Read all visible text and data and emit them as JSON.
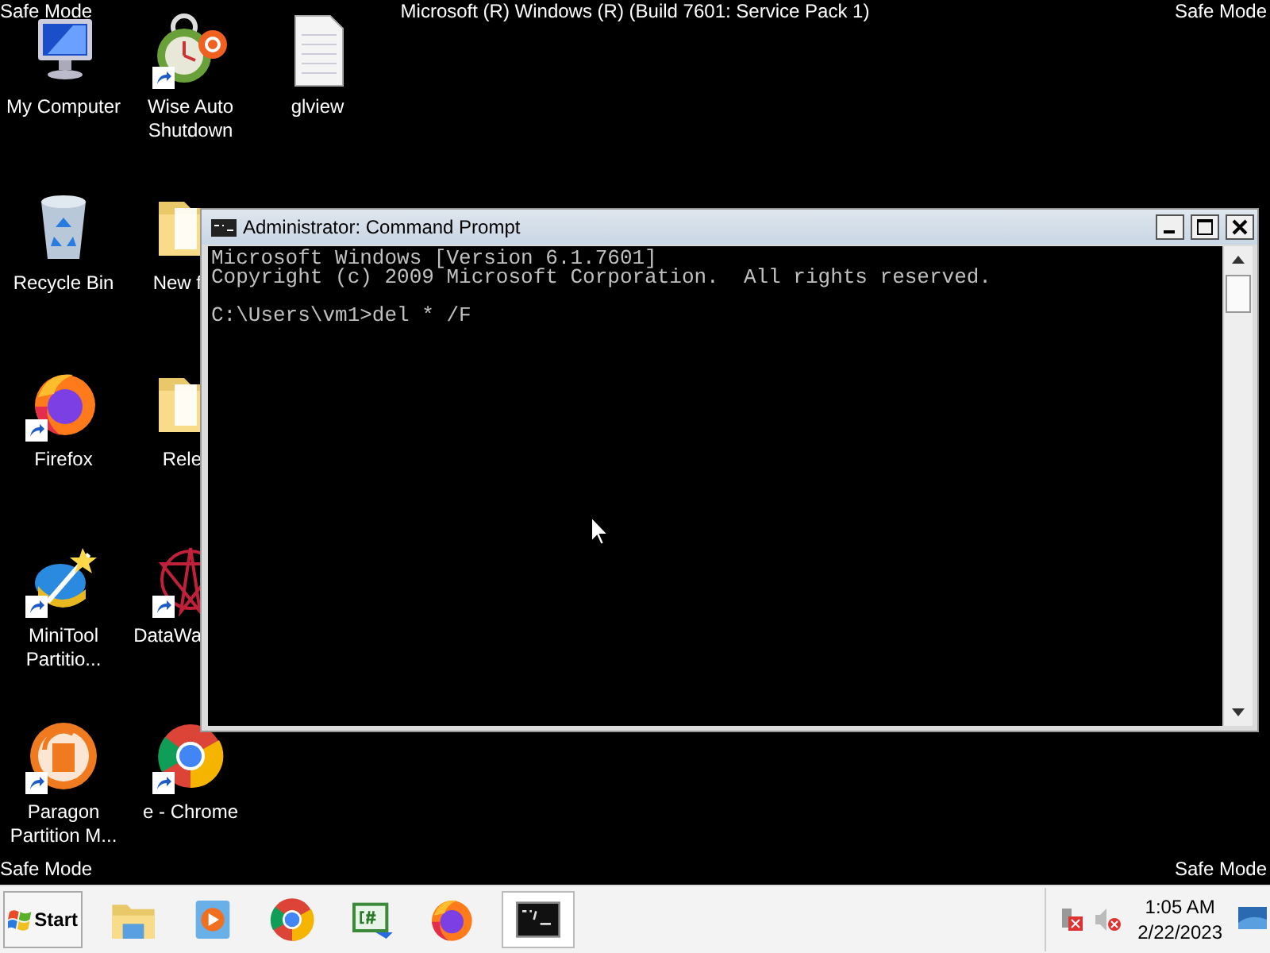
{
  "overlay_labels": {
    "top_left": "Safe Mode",
    "top_center": "Microsoft (R) Windows (R) (Build 7601: Service Pack 1)",
    "top_right": "Safe Mode",
    "bottom_left": "Safe Mode",
    "bottom_right": "Safe Mode"
  },
  "desktop_icons": [
    {
      "label": "My Computer",
      "kind": "computer",
      "shortcut": false,
      "covered": false
    },
    {
      "label": "Recycle Bin",
      "kind": "recycle",
      "shortcut": false,
      "covered": false
    },
    {
      "label": "Firefox",
      "kind": "firefox",
      "shortcut": true,
      "covered": false
    },
    {
      "label": "MiniTool Partitio...",
      "kind": "minitool",
      "shortcut": true,
      "covered": false
    },
    {
      "label": "Paragon Partition M...",
      "kind": "paragon",
      "shortcut": true,
      "covered": false
    },
    {
      "label": "Wise Auto Shutdown",
      "kind": "clock",
      "shortcut": true,
      "covered": false
    },
    {
      "label": "New f",
      "kind": "folder",
      "shortcut": false,
      "covered": true
    },
    {
      "label": "Rele",
      "kind": "folder",
      "shortcut": false,
      "covered": true
    },
    {
      "label": "DataWa",
      "kind": "datawave",
      "shortcut": true,
      "covered": true
    },
    {
      "label": "e - Chrome",
      "kind": "chrome",
      "shortcut": true,
      "covered": false
    },
    {
      "label": "glview",
      "kind": "file",
      "shortcut": false,
      "covered": false
    }
  ],
  "console_window": {
    "title": "Administrator: Command Prompt",
    "lines": [
      {
        "text": "Microsoft Windows [Version 6.1.7601]",
        "gap_before": false
      },
      {
        "text": "Copyright (c) 2009 Microsoft Corporation.  All rights reserved.",
        "gap_before": false
      },
      {
        "text": "C:\\Users\\vm1>del * /F",
        "gap_before": true
      }
    ]
  },
  "taskbar": {
    "start_label": "Start",
    "items": [
      {
        "kind": "explorer",
        "selected": false
      },
      {
        "kind": "media",
        "selected": false
      },
      {
        "kind": "chrome",
        "selected": false
      },
      {
        "kind": "csharp",
        "selected": false
      },
      {
        "kind": "firefox",
        "selected": false
      },
      {
        "kind": "console",
        "selected": true
      }
    ],
    "time": "1:05 AM",
    "date": "2/22/2023"
  }
}
